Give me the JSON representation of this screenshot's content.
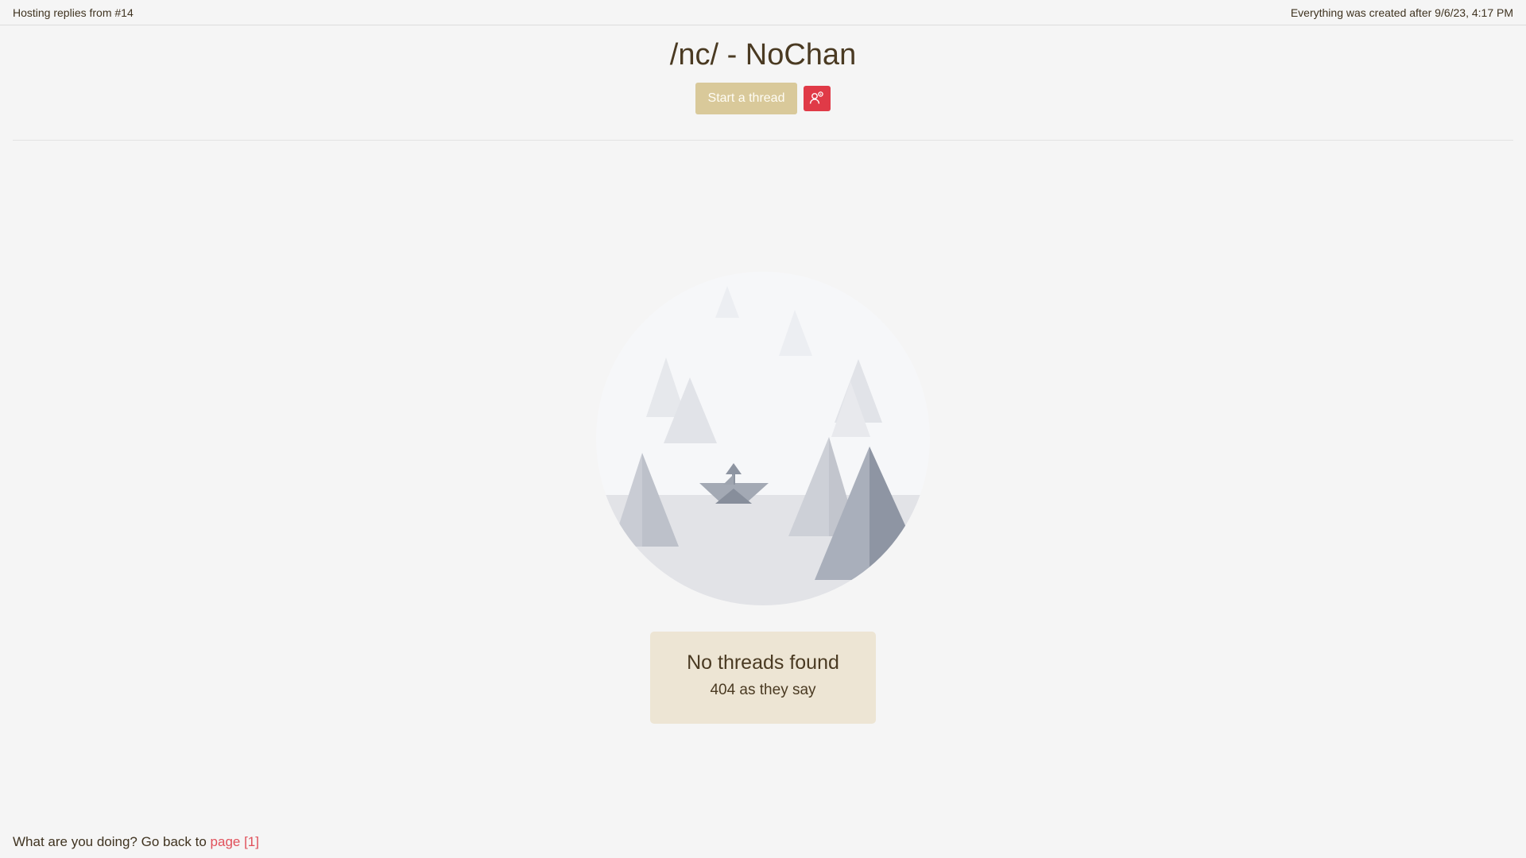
{
  "topbar": {
    "left_text": "Hosting replies from #14",
    "right_text": "Everything was created after 9/6/23, 4:17 PM"
  },
  "header": {
    "title": "/nc/ - NoChan",
    "start_thread_label": "Start a thread",
    "user_icon": "user-gear-icon"
  },
  "empty_state": {
    "illustration": "empty-lake-boat-illustration",
    "heading": "No threads found",
    "subheading": "404 as they say"
  },
  "footer": {
    "prefix": "What are you doing? Go back to",
    "link_label": "page [1]"
  },
  "colors": {
    "background": "#f5f5f5",
    "text": "#4a3a22",
    "start_button": "#d9c99a",
    "user_button": "#e03a47",
    "notice_bg": "#ede5d4",
    "link": "#e0505a"
  }
}
